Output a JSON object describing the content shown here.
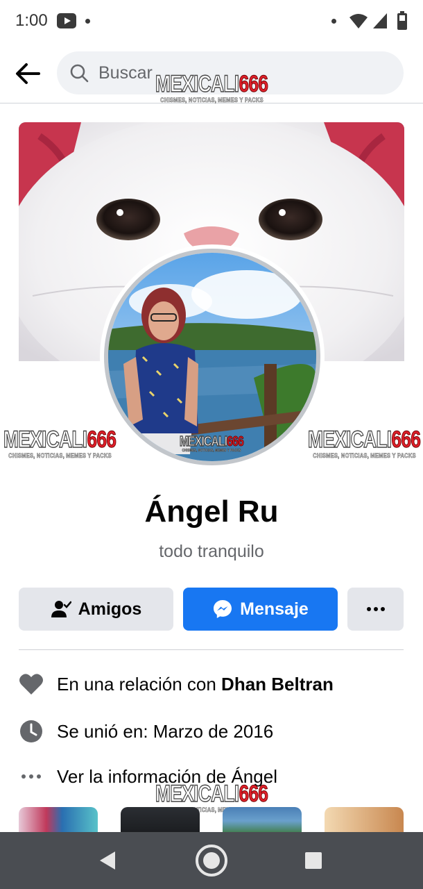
{
  "status_bar": {
    "time": "1:00"
  },
  "header": {
    "search_placeholder": "Buscar"
  },
  "watermark": {
    "brand_white": "MEXICALI",
    "brand_red": "666",
    "tagline": "CHISMES, NOTICIAS, MEMES Y PACKS"
  },
  "profile": {
    "name": "Ángel Ru",
    "bio": "todo tranquilo"
  },
  "actions": {
    "friends_label": "Amigos",
    "message_label": "Mensaje"
  },
  "info": {
    "relationship_prefix": "En una relación con ",
    "relationship_partner": "Dhan Beltran",
    "joined": "Se unió en: Marzo de 2016",
    "see_info": "Ver la información de Ángel"
  },
  "colors": {
    "accent": "#1877f2",
    "secondary_button": "#e4e6eb",
    "muted_text": "#65676b",
    "nav_bar": "#4a4d52"
  },
  "icons": {
    "back": "arrow-left-icon",
    "search": "search-icon",
    "friends": "person-check-icon",
    "message": "messenger-icon",
    "more": "more-dots-icon",
    "relationship": "heart-icon",
    "joined": "clock-icon",
    "see_info": "more-dots-icon"
  }
}
